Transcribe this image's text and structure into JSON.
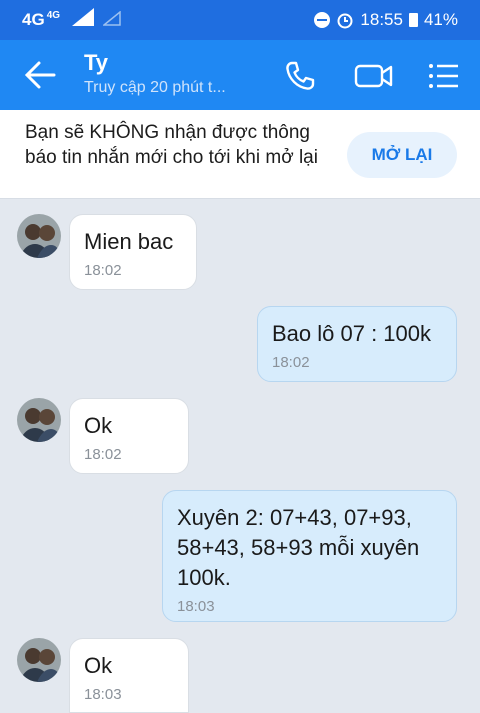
{
  "status_bar": {
    "network": "4G",
    "network_small": "4G",
    "time": "18:55",
    "battery": "41%"
  },
  "header": {
    "title": "Ty",
    "subtitle": "Truy cập 20 phút t..."
  },
  "notice": {
    "text": "Bạn sẽ KHÔNG nhận được thông báo tin nhắn mới cho tới khi mở lại",
    "button_label": "MỞ LẠI"
  },
  "messages": [
    {
      "direction": "in",
      "text": "Mien bac",
      "time": "18:02"
    },
    {
      "direction": "out",
      "text": "Bao lô 07 : 100k",
      "time": "18:02"
    },
    {
      "direction": "in",
      "text": "Ok",
      "time": "18:02"
    },
    {
      "direction": "out",
      "text": "Xuyên 2: 07+43, 07+93, 58+43, 58+93 mỗi xuyên 100k.",
      "time": "18:03"
    },
    {
      "direction": "in",
      "text": "Ok",
      "time": "18:03"
    }
  ],
  "colors": {
    "status_bar": "#1f6ee0",
    "header": "#1f88f3",
    "chat_background": "#e3e8ef",
    "outgoing_bubble": "#d7ecfc",
    "accent": "#1a7ae8"
  },
  "icons": [
    "back-arrow-icon",
    "phone-icon",
    "video-call-icon",
    "menu-list-icon",
    "dnd-icon",
    "alarm-icon",
    "battery-icon",
    "signal-icon"
  ]
}
